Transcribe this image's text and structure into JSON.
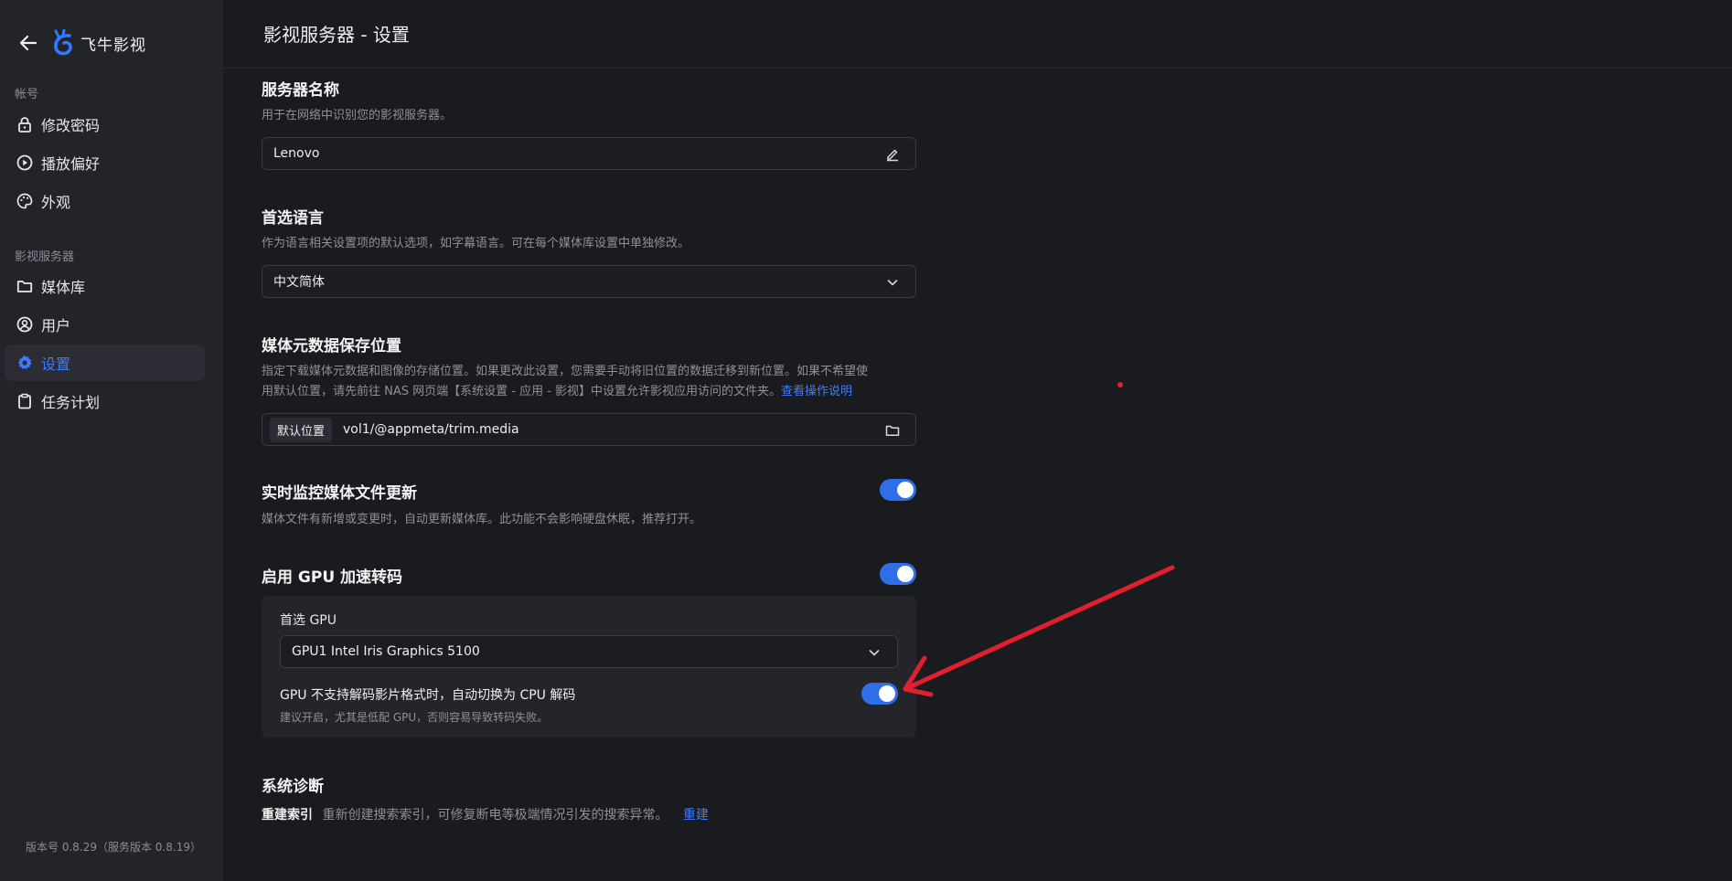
{
  "app": {
    "name": "飞牛影视"
  },
  "sidebar": {
    "groups": [
      {
        "title": "帐号",
        "items": [
          {
            "label": "修改密码",
            "icon": "lock-icon"
          },
          {
            "label": "播放偏好",
            "icon": "play-circle-icon"
          },
          {
            "label": "外观",
            "icon": "palette-icon"
          }
        ]
      },
      {
        "title": "影视服务器",
        "items": [
          {
            "label": "媒体库",
            "icon": "folder-icon"
          },
          {
            "label": "用户",
            "icon": "user-circle-icon"
          },
          {
            "label": "设置",
            "icon": "gear-icon",
            "active": true
          },
          {
            "label": "任务计划",
            "icon": "clipboard-icon"
          }
        ]
      }
    ],
    "version": "版本号 0.8.29（服务版本 0.8.19）"
  },
  "page": {
    "title": "影视服务器 - 设置"
  },
  "settings": {
    "server_name": {
      "title": "服务器名称",
      "desc": "用于在网络中识别您的影视服务器。",
      "value": "Lenovo"
    },
    "language": {
      "title": "首选语言",
      "desc": "作为语言相关设置项的默认选项，如字幕语言。可在每个媒体库设置中单独修改。",
      "value": "中文简体"
    },
    "metadata": {
      "title": "媒体元数据保存位置",
      "desc_line1": "指定下载媒体元数据和图像的存储位置。如果更改此设置，您需要手动将旧位置的数据迁移到新位置。如果不希望使",
      "desc_line2": "用默认位置，请先前往 NAS 网页端【系统设置 - 应用 - 影视】中设置允许影视应用访问的文件夹。",
      "link": "查看操作说明",
      "chip": "默认位置",
      "path": "vol1/@appmeta/trim.media"
    },
    "monitor": {
      "title": "实时监控媒体文件更新",
      "desc": "媒体文件有新增或变更时，自动更新媒体库。此功能不会影响硬盘休眠，推荐打开。",
      "enabled": true
    },
    "gpu": {
      "title": "启用 GPU 加速转码",
      "enabled": true,
      "preferred_label": "首选 GPU",
      "preferred_value": "GPU1 Intel Iris Graphics 5100",
      "fallback_title": "GPU 不支持解码影片格式时，自动切换为 CPU 解码",
      "fallback_desc": "建议开启，尤其是低配 GPU，否则容易导致转码失败。",
      "fallback_enabled": true
    },
    "diagnostics": {
      "title": "系统诊断",
      "rebuild_label": "重建索引",
      "rebuild_desc": "重新创建搜索索引，可修复断电等极端情况引发的搜索异常。",
      "rebuild_link": "重建"
    }
  },
  "colors": {
    "accent": "#2f6de9",
    "annotation_arrow": "#e0202e"
  }
}
